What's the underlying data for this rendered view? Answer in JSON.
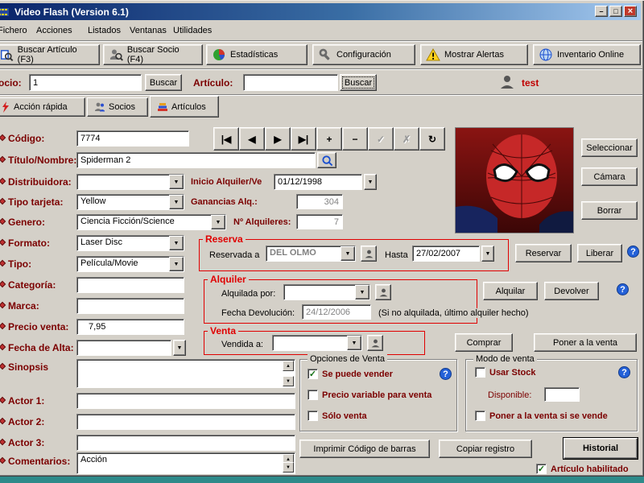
{
  "titlebar": {
    "title": "Video Flash (Version 6.1)"
  },
  "window_controls": {
    "minimize": "–",
    "maximize": "□",
    "close": "×"
  },
  "menu": [
    "Fichero",
    "Acciones",
    "Listados",
    "Ventanas",
    "Utilidades"
  ],
  "toolbar": [
    "Buscar Artículo (F3)",
    "Buscar Socio (F4)",
    "Estadísticas",
    "Configuración",
    "Mostrar Alertas",
    "Inventario Online"
  ],
  "quick": {
    "socio_label": "Socio:",
    "socio_value": "1",
    "socio_buscar": "Buscar",
    "articulo_label": "Artículo:",
    "articulo_value": "",
    "articulo_buscar": "Buscar",
    "user_name": "test"
  },
  "tabs": [
    "Acción rápida",
    "Socios",
    "Artículos"
  ],
  "nav": [
    "|◀",
    "◀",
    "▶",
    "▶|",
    "+",
    "−",
    "✓",
    "✗",
    "↻"
  ],
  "fields": {
    "codigo": {
      "label": "Código:",
      "value": "7774"
    },
    "titulo": {
      "label": "Título/Nombre:",
      "value": "Spiderman 2"
    },
    "distribuidora": {
      "label": "Distribuidora:",
      "value": ""
    },
    "inicio": {
      "label": "Inicio Alquiler/Ve",
      "value": "01/12/1998"
    },
    "tarjeta": {
      "label": "Tipo tarjeta:",
      "value": "Yellow"
    },
    "ganancias": {
      "label": "Ganancias Alq.:",
      "value": "304"
    },
    "genero": {
      "label": "Genero:",
      "value": "Ciencia Ficción/Science"
    },
    "alquileres": {
      "label": "Nº Alquileres:",
      "value": "7"
    },
    "formato": {
      "label": "Formato:",
      "value": "Laser Disc"
    },
    "tipo": {
      "label": "Tipo:",
      "value": "Película/Movie"
    },
    "categoria": {
      "label": "Categoría:",
      "value": ""
    },
    "marca": {
      "label": "Marca:",
      "value": ""
    },
    "precio": {
      "label": "Precio venta:",
      "value": "7,95"
    },
    "fecha_alta": {
      "label": "Fecha de Alta:",
      "value": ""
    },
    "sinopsis": {
      "label": "Sinopsis",
      "value": ""
    },
    "actor1": {
      "label": "Actor 1:",
      "value": ""
    },
    "actor2": {
      "label": "Actor 2:",
      "value": ""
    },
    "actor3": {
      "label": "Actor 3:",
      "value": ""
    },
    "comentarios": {
      "label": "Comentarios:",
      "value": "Acción"
    }
  },
  "poster_buttons": {
    "seleccionar": "Seleccionar",
    "camara": "Cámara",
    "borrar": "Borrar"
  },
  "reserva": {
    "title": "Reserva",
    "reservada_a": "Reservada a",
    "reservada_value": "DEL OLMO",
    "hasta": "Hasta",
    "hasta_value": "27/02/2007",
    "reservar": "Reservar",
    "liberar": "Liberar"
  },
  "alquiler": {
    "title": "Alquiler",
    "alquilada_por": "Alquilada por:",
    "alquilada_value": "",
    "alquilar": "Alquilar",
    "devolver": "Devolver",
    "fecha_devolucion": "Fecha Devolución:",
    "fecha_devolucion_value": "24/12/2006",
    "nota": "(Si no alquilada, último alquiler hecho)"
  },
  "venta": {
    "title": "Venta",
    "vendida_a": "Vendida a:",
    "vendida_value": "",
    "comprar": "Comprar",
    "poner": "Poner a la venta"
  },
  "opciones_venta": {
    "title": "Opciones de Venta",
    "se_puede": "Se puede vender",
    "precio_variable": "Precio variable para venta",
    "solo_venta": "Sólo venta"
  },
  "modo_venta": {
    "title": "Modo de venta",
    "usar_stock": "Usar Stock",
    "disponible": "Disponible:",
    "disponible_value": "",
    "poner_si_vende": "Poner a la venta si se vende"
  },
  "bottom": {
    "imprimir": "Imprimir Código de barras",
    "copiar": "Copiar registro",
    "historial": "Historial",
    "habilitado": "Artículo habilitado"
  },
  "checks": {
    "se_puede": "✓",
    "precio_variable": "",
    "solo_venta": "",
    "usar_stock": "",
    "poner_si_vende": "",
    "habilitado": "✓"
  },
  "icons": {
    "down": "▼",
    "up": "▲",
    "help": "?"
  },
  "colors": {
    "accent_red": "#e00000",
    "label_maroon": "#7b0000",
    "desktop_teal": "#2e8a8a"
  }
}
